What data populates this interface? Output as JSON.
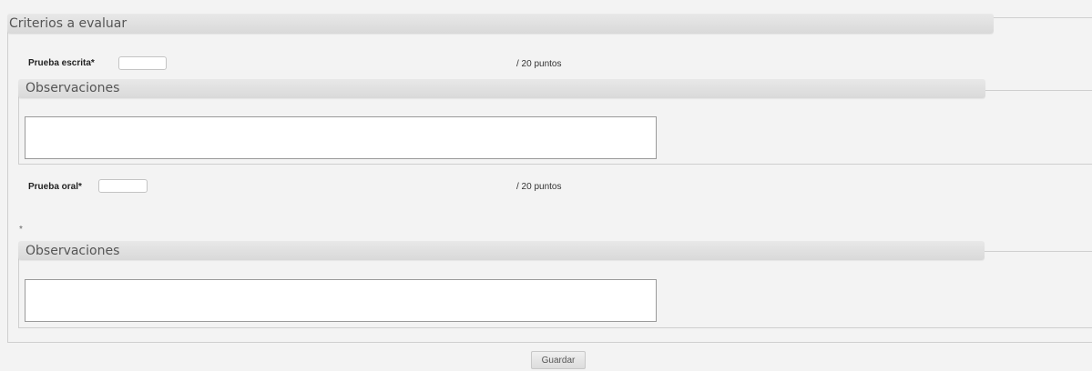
{
  "form": {
    "section_title": "Criterios a evaluar",
    "criteria": [
      {
        "label": "Prueba escrita*",
        "score_value": "",
        "points_suffix": "/ 20 puntos",
        "observations_title": "Observaciones",
        "observations_value": ""
      },
      {
        "label": "Prueba oral*",
        "score_value": "",
        "points_suffix": "/ 20 puntos",
        "observations_title": "Observaciones",
        "observations_value": ""
      }
    ],
    "stray_asterisk": "*",
    "save_label": "Guardar"
  }
}
